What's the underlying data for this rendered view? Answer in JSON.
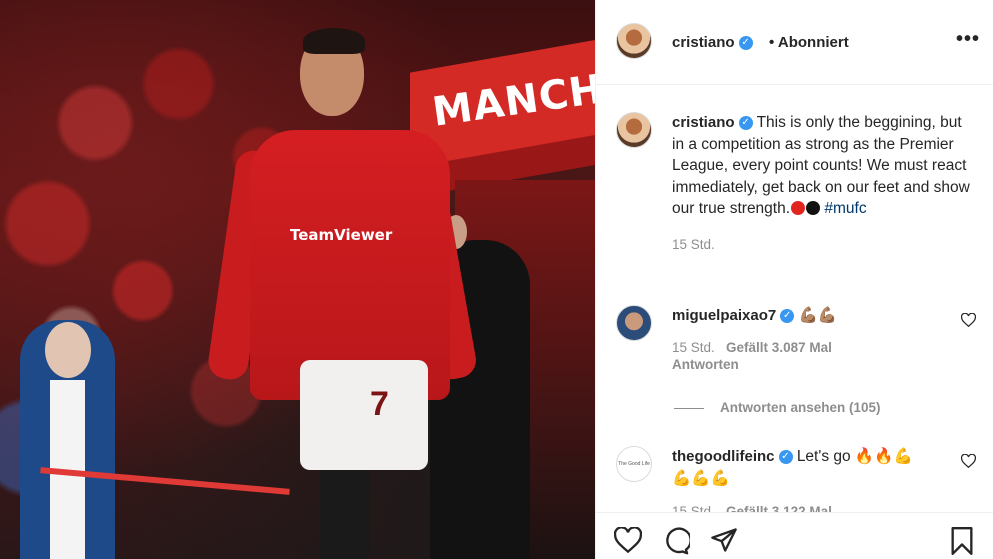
{
  "photo": {
    "banner_text": "MANCH",
    "sponsor": "TeamViewer",
    "shorts_number": "7"
  },
  "header": {
    "username": "cristiano",
    "separator": "•",
    "follow_status": "Abonniert",
    "more": "•••"
  },
  "caption": {
    "username": "cristiano",
    "text": "This is only the beggining, but in a competition as strong as the Premier League, every point counts! We must react immediately, get back on our feet and show our true strength.",
    "hashtag": "#mufc",
    "time": "15 Std."
  },
  "comments": [
    {
      "username": "miguelpaixao7",
      "text": "💪🏽💪🏽",
      "time": "15 Std.",
      "likes": "Gefällt 3.087 Mal",
      "reply": "Antworten",
      "view_replies": "Antworten ansehen (105)"
    },
    {
      "username": "thegoodlifeinc",
      "text": "Let's go 🔥🔥💪",
      "text2": "💪💪💪",
      "time": "15 Std.",
      "likes": "Gefällt 3.122 Mal"
    }
  ],
  "icons": {
    "verified": "verified-badge-icon",
    "like": "heart-icon",
    "comment": "comment-icon",
    "share": "paper-plane-icon",
    "save": "bookmark-icon"
  },
  "colors": {
    "verified_blue": "#3897f0",
    "text": "#262626",
    "muted": "#8e8e8e",
    "hashtag": "#00376b"
  }
}
